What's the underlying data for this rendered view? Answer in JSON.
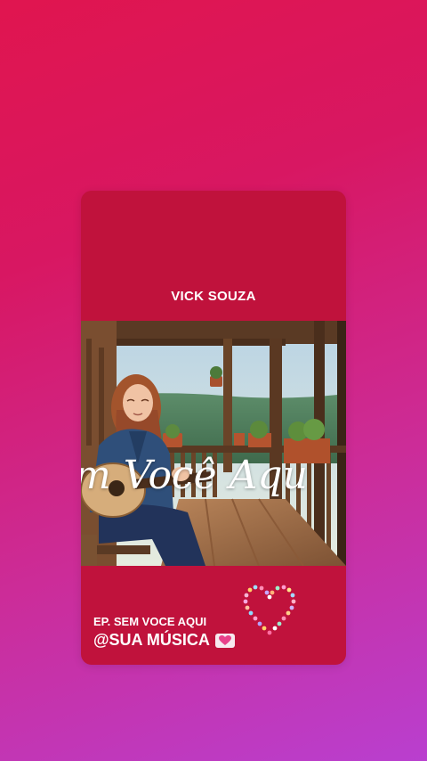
{
  "story": {
    "artist": "VICK SOUZA",
    "cover_title": "m Você Aqu",
    "ep_label": "EP. SEM VOCE AQUI",
    "sticker_text": "@SUA MÚSICA",
    "icons": [
      "heart-emoji-icon",
      "heart-sticker-icon"
    ]
  },
  "colors": {
    "background_top": "#e0154f",
    "background_bottom": "#b93fcf",
    "card": "#c0123c",
    "text": "#ffffff"
  }
}
